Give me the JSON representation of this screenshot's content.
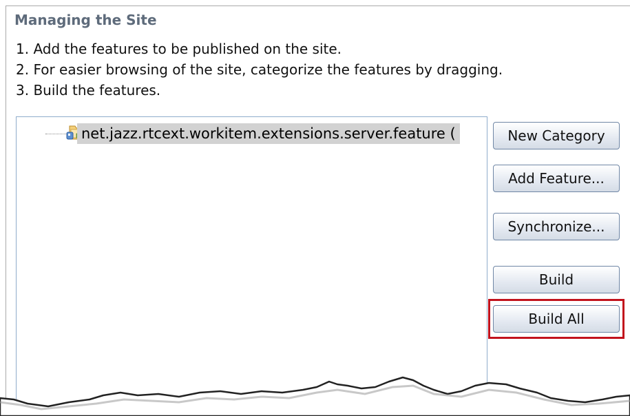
{
  "section": {
    "title": "Managing the Site",
    "steps": [
      "1. Add the features to be published on the site.",
      "2. For easier browsing of the site, categorize the features by dragging.",
      "3. Build the features."
    ]
  },
  "tree": {
    "items": [
      {
        "label": "net.jazz.rtcext.workitem.extensions.server.feature (",
        "icon": "feature-plugin-icon",
        "selected": true
      }
    ]
  },
  "buttons": {
    "new_category": "New Category",
    "add_feature": "Add Feature...",
    "synchronize": "Synchronize...",
    "build": "Build",
    "build_all": "Build All"
  },
  "colors": {
    "highlight": "#c2121c",
    "title": "#5e6b7b",
    "selection": "#d2d2d2",
    "panel_border": "#8faccb"
  }
}
